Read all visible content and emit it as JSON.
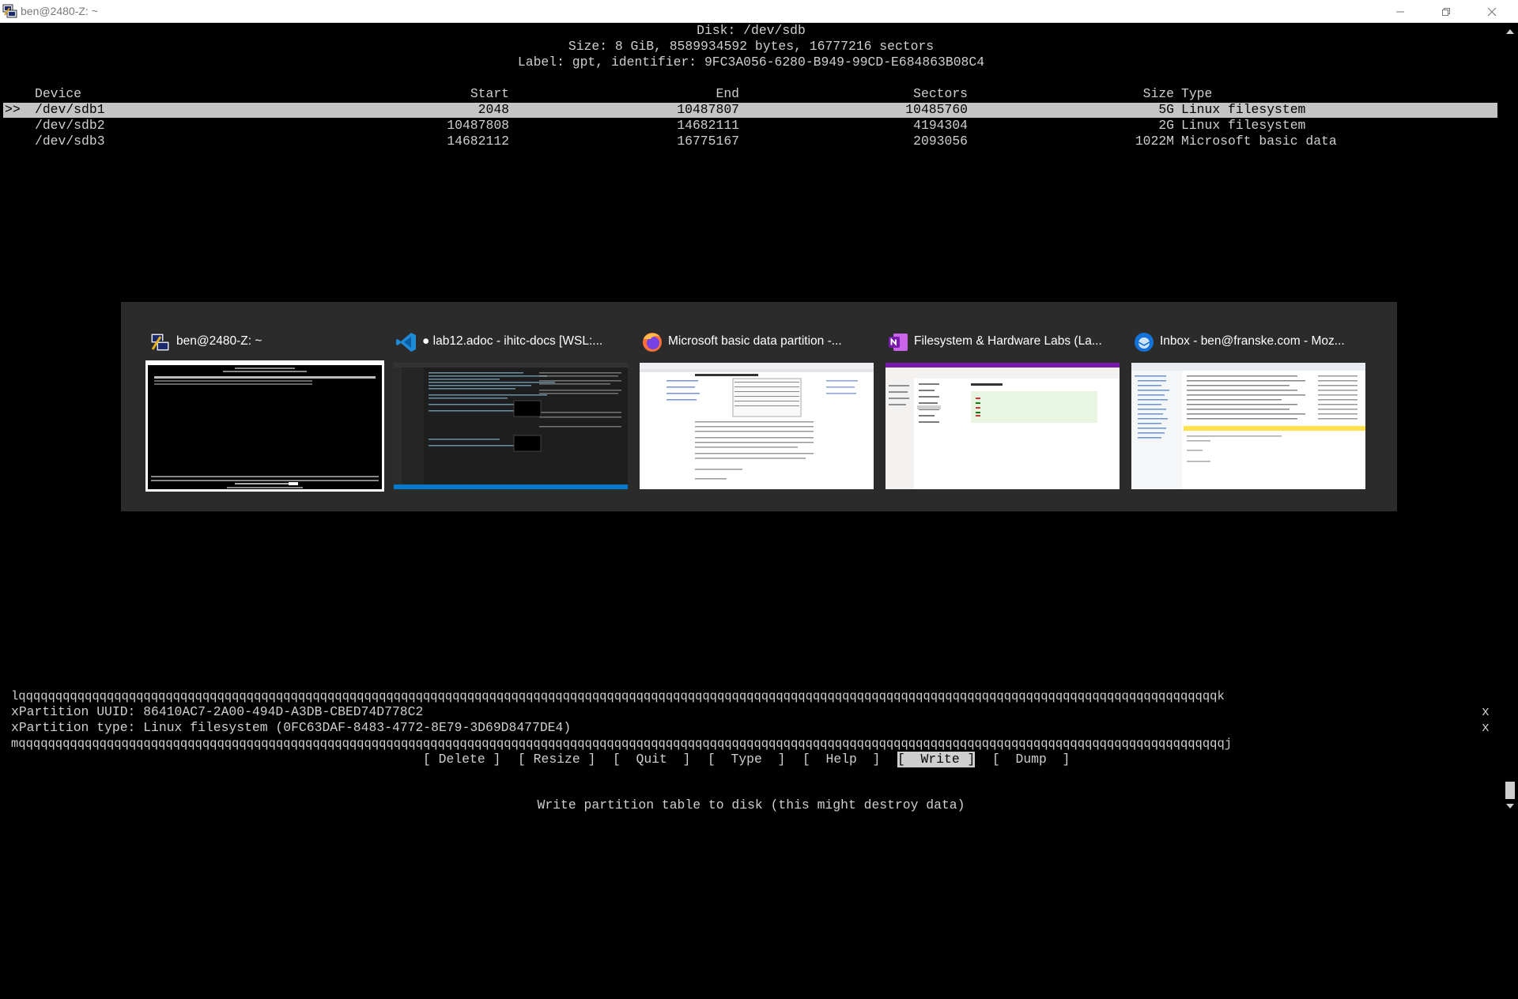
{
  "window": {
    "title": "ben@2480-Z: ~"
  },
  "disk": {
    "heading": "Disk: /dev/sdb",
    "size_line": "Size: 8 GiB, 8589934592 bytes, 16777216 sectors",
    "label_line": "Label: gpt, identifier: 9FC3A056-6280-B949-99CD-E684863B08C4"
  },
  "table": {
    "columns": {
      "device": "Device",
      "start": "Start",
      "end": "End",
      "sectors": "Sectors",
      "size": "Size",
      "type": "Type"
    },
    "cursor": ">>",
    "rows": [
      {
        "device": "/dev/sdb1",
        "start": "2048",
        "end": "10487807",
        "sectors": "10485760",
        "size": "5G",
        "type": "Linux filesystem"
      },
      {
        "device": "/dev/sdb2",
        "start": "10487808",
        "end": "14682111",
        "sectors": "4194304",
        "size": "2G",
        "type": "Linux filesystem"
      },
      {
        "device": "/dev/sdb3",
        "start": "14682112",
        "end": "16775167",
        "sectors": "2093056",
        "size": "1022M",
        "type": "Microsoft basic data"
      }
    ]
  },
  "info_box": {
    "top_border": "lqqqqqqqqqqqqqqqqqqqqqqqqqqqqqqqqqqqqqqqqqqqqqqqqqqqqqqqqqqqqqqqqqqqqqqqqqqqqqqqqqqqqqqqqqqqqqqqqqqqqqqqqqqqqqqqqqqqqqqqqqqqqqqqqqqqqqqqqqqqqqqqqqqqqqqqqqqqqqqqqqqqk",
    "bottom_border": "mqqqqqqqqqqqqqqqqqqqqqqqqqqqqqqqqqqqqqqqqqqqqqqqqqqqqqqqqqqqqqqqqqqqqqqqqqqqqqqqqqqqqqqqqqqqqqqqqqqqqqqqqqqqqqqqqqqqqqqqqqqqqqqqqqqqqqqqqqqqqqqqqqqqqqqqqqqqqqqqqqqqqj",
    "uuid_line": "xPartition UUID: 86410AC7-2A00-494D-A3DB-CBED74D778C2",
    "type_line": "xPartition type: Linux filesystem (0FC63DAF-8483-4772-8E79-3D69D8477DE4)",
    "right_edge": "x"
  },
  "menu": {
    "delete": "[ Delete ]",
    "resize": "[ Resize ]",
    "quit": "[  Quit  ]",
    "type": "[  Type  ]",
    "help": "[  Help  ]",
    "write": "[  Write ]",
    "dump": "[  Dump  ]",
    "status": "Write partition table to disk (this might destroy data)"
  },
  "switcher": {
    "items": [
      {
        "title": "ben@2480-Z: ~",
        "icon": "putty-icon",
        "selected": true
      },
      {
        "title": "● lab12.adoc - ihitc-docs [WSL:...",
        "icon": "vscode-icon",
        "selected": false
      },
      {
        "title": "Microsoft basic data partition -...",
        "icon": "firefox-icon",
        "selected": false
      },
      {
        "title": "Filesystem & Hardware Labs (La...",
        "icon": "onenote-icon",
        "selected": false
      },
      {
        "title": "Inbox - ben@franske.com - Moz...",
        "icon": "thunderbird-icon",
        "selected": false
      }
    ]
  },
  "colors": {
    "terminal_bg": "#000000",
    "terminal_fg": "#cfcfcf",
    "selection_bg": "#c4c4c4",
    "switcher_bg": "#2b2b2b"
  }
}
